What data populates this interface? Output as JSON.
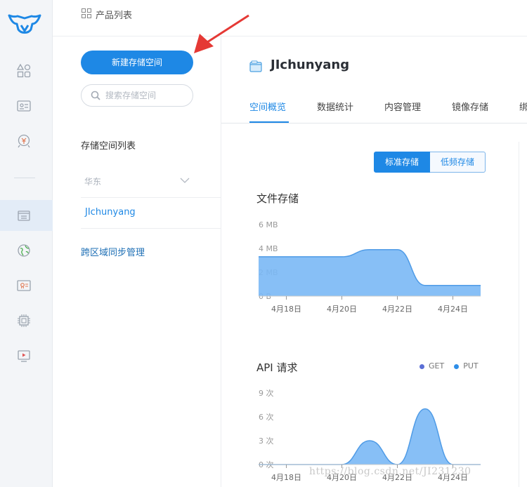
{
  "topbar": {
    "title": "产品列表",
    "icon": "grid-icon"
  },
  "sidebar": {
    "new_button": "新建存储空间",
    "search_placeholder": "搜索存储空间",
    "list_title": "存储空间列表",
    "region": "华东",
    "bucket": "JIchunyang",
    "cross_region": "跨区域同步管理"
  },
  "rail": {
    "icons": [
      "logo-icon",
      "products-icon",
      "id-card-icon",
      "billing-icon",
      "storage-icon",
      "cdn-globe-icon",
      "certificate-icon",
      "chip-icon",
      "media-icon"
    ]
  },
  "bucket_header": {
    "name": "JIchunyang"
  },
  "tabs": [
    "空间概览",
    "数据统计",
    "内容管理",
    "镜像存储",
    "绑"
  ],
  "storage_type": {
    "standard": "标准存储",
    "low_freq": "低频存储",
    "selected": "标准存储"
  },
  "file_storage": {
    "title": "文件存储"
  },
  "api": {
    "title": "API 请求",
    "legend": [
      {
        "name": "GET",
        "color": "#5b6fd6"
      },
      {
        "name": "PUT",
        "color": "#2e8ee8"
      }
    ]
  },
  "colors": {
    "accent": "#1e88e5",
    "area_fill": "#7ab8f5",
    "area_line": "#4f9be6"
  },
  "watermark": "https://blog.csdn.net/JI231230",
  "chart_data": [
    {
      "type": "area",
      "title": "文件存储",
      "yticks": [
        "6 MB",
        "4 MB",
        "2 MB",
        "0 B"
      ],
      "ylim": [
        0,
        6
      ],
      "xticks": [
        "4月18日",
        "4月20日",
        "4月22日",
        "4月24日"
      ],
      "x": [
        17,
        18,
        19,
        20,
        21,
        22,
        23,
        24,
        25
      ],
      "series": [
        {
          "values": [
            3.3,
            3.3,
            3.3,
            3.3,
            3.9,
            3.9,
            0.9,
            0.9,
            0.9
          ]
        }
      ]
    },
    {
      "type": "area",
      "title": "API 请求",
      "yticks": [
        "9 次",
        "6 次",
        "3 次",
        "0 次"
      ],
      "ylim": [
        0,
        9
      ],
      "xticks": [
        "4月18日",
        "4月20日",
        "4月22日",
        "4月24日"
      ],
      "x": [
        17,
        18,
        19,
        20,
        21,
        22,
        23,
        24,
        25
      ],
      "series": [
        {
          "values": [
            0,
            0,
            0,
            0,
            3,
            0,
            7,
            0,
            0
          ]
        }
      ]
    }
  ]
}
